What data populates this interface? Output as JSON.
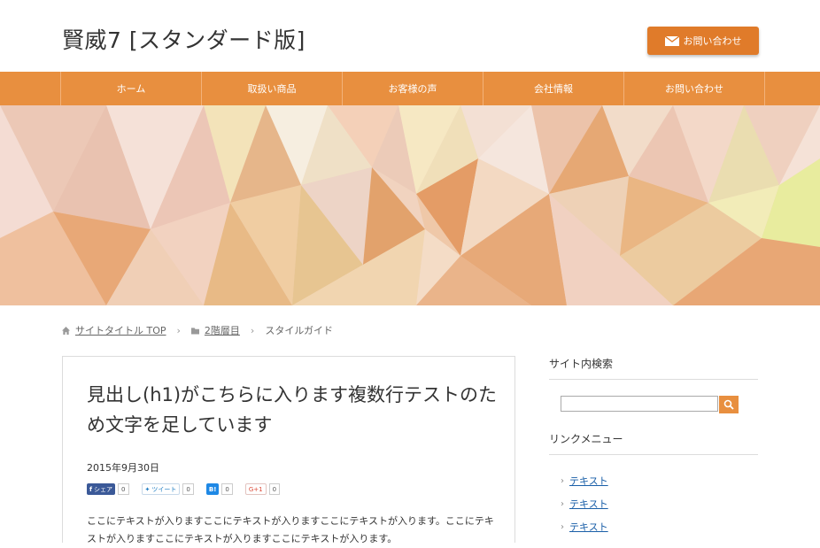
{
  "header": {
    "site_title": "賢威7 [スタンダード版]",
    "contact_label": "お問い合わせ"
  },
  "nav": {
    "items": [
      {
        "label": "ホーム"
      },
      {
        "label": "取扱い商品"
      },
      {
        "label": "お客様の声"
      },
      {
        "label": "会社情報"
      },
      {
        "label": "お問い合わせ"
      }
    ]
  },
  "breadcrumb": {
    "home": "サイトタイトル TOP",
    "category": "2階層目",
    "current": "スタイルガイド"
  },
  "article": {
    "title": "見出し(h1)がこちらに入ります複数行テストのため文字を足しています",
    "date": "2015年9月30日",
    "social": {
      "facebook_label": "シェア",
      "facebook_count": "0",
      "twitter_label": "ツイート",
      "twitter_count": "0",
      "hatena_label": "B!",
      "hatena_count": "0",
      "google_label": "G+1",
      "google_count": "0"
    },
    "body": "ここにテキストが入りますここにテキストが入りますここにテキストが入ります。ここにテキストが入りますここにテキストが入りますここにテキストが入ります。"
  },
  "sidebar": {
    "search_title": "サイト内検索",
    "search_value": "",
    "menu_title": "リンクメニュー",
    "menu_items": [
      {
        "label": "テキスト"
      },
      {
        "label": "テキスト"
      },
      {
        "label": "テキスト"
      }
    ]
  },
  "colors": {
    "accent": "#e88f3f",
    "button": "#e07b2a"
  }
}
